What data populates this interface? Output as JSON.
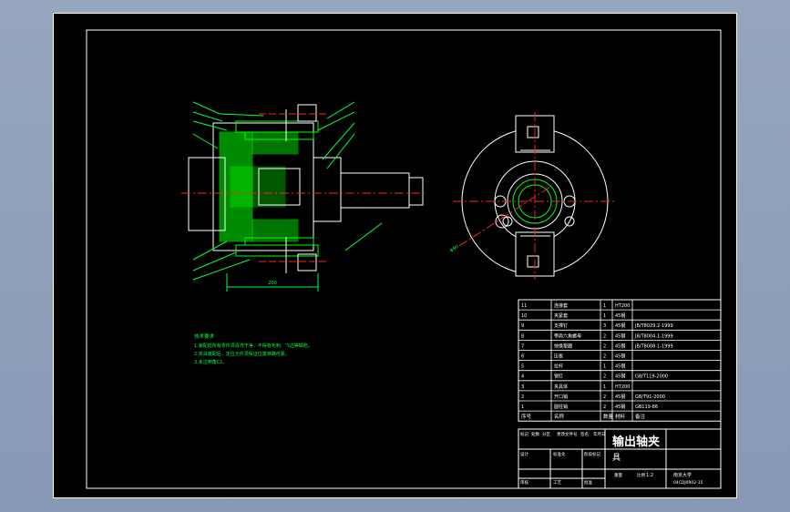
{
  "drawing": {
    "title_main": "输出轴夹",
    "title_sub": "具",
    "scale": "1:2",
    "school": "南京大学",
    "drawing_no": "04CDJ0902-15",
    "title_labels": [
      "标记",
      "处数",
      "分区",
      "更改文件号",
      "签名",
      "年月日",
      "设计",
      "标准化",
      "阶段标记",
      "重量",
      "比例",
      "审核",
      "工艺",
      "批准"
    ]
  },
  "notes": {
    "heading": "技术要求",
    "lines": [
      "1.装配前所有零件须清洗干净，不得有毛刺、飞边等缺陷。",
      "2.夹具装配后，定位元件须保证位置准确可靠。",
      "3.未注倒角C1。"
    ]
  },
  "dimensions": {
    "overall_width": "200",
    "diameter": "Φ90"
  },
  "bom": {
    "headers": [
      "序号",
      "名称",
      "数量",
      "材料",
      "备注"
    ],
    "rows": [
      {
        "no": "11",
        "name": "连接套",
        "qty": "1",
        "mat": "HT200",
        "note": ""
      },
      {
        "no": "10",
        "name": "夹紧套",
        "qty": "1",
        "mat": "45钢",
        "note": ""
      },
      {
        "no": "9",
        "name": "支撑钉",
        "qty": "3",
        "mat": "45钢",
        "note": "JB/T8029.2-1999"
      },
      {
        "no": "8",
        "name": "带肩六角螺母",
        "qty": "2",
        "mat": "45钢",
        "note": "JB/T8004.1-1999"
      },
      {
        "no": "7",
        "name": "快换垫圈",
        "qty": "2",
        "mat": "45钢",
        "note": "JB/T8008.1-1999"
      },
      {
        "no": "6",
        "name": "压板",
        "qty": "2",
        "mat": "45钢",
        "note": ""
      },
      {
        "no": "5",
        "name": "拉杆",
        "qty": "1",
        "mat": "45钢",
        "note": ""
      },
      {
        "no": "4",
        "name": "销钉",
        "qty": "2",
        "mat": "45钢",
        "note": "GB/T119-2000"
      },
      {
        "no": "3",
        "name": "夹具体",
        "qty": "1",
        "mat": "HT200",
        "note": ""
      },
      {
        "no": "2",
        "name": "开口销",
        "qty": "2",
        "mat": "45钢",
        "note": "GB/T91-2000"
      },
      {
        "no": "1",
        "name": "圆柱销",
        "qty": "2",
        "mat": "45钢",
        "note": "GB119-86"
      }
    ]
  },
  "colors": {
    "outline": "#ffffff",
    "centerline": "#ff2222",
    "section": "#00ff00",
    "annotation": "#00ff44"
  }
}
